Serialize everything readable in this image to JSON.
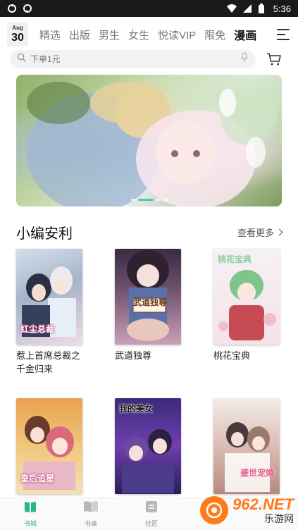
{
  "status_bar": {
    "time": "5:36"
  },
  "top_nav": {
    "date": {
      "month": "Aug",
      "day": "30"
    },
    "tabs": [
      {
        "label": "精选"
      },
      {
        "label": "出版"
      },
      {
        "label": "男生"
      },
      {
        "label": "女生"
      },
      {
        "label": "悦读VIP"
      },
      {
        "label": "限免"
      },
      {
        "label": "漫画",
        "active": true
      }
    ]
  },
  "search": {
    "placeholder": "下单1元"
  },
  "banner": {
    "slide_count": 4,
    "active_slide": 1
  },
  "section": {
    "title": "小编安利",
    "see_more": "查看更多",
    "books": [
      {
        "title": "惹上首席总裁之千金归来",
        "cover_text": "红尘总裁"
      },
      {
        "title": "武道独尊",
        "cover_text": "武道独尊"
      },
      {
        "title": "桃花宝典",
        "cover_text": "桃花宝典"
      },
      {
        "title": "",
        "cover_text": "皇后追星"
      },
      {
        "title": "",
        "cover_text": "我的美女"
      },
      {
        "title": "",
        "cover_text": "盛世宠婚"
      }
    ]
  },
  "bottom_nav": {
    "items": [
      {
        "label": "书城",
        "active": true
      },
      {
        "label": "书桌"
      },
      {
        "label": "社区"
      }
    ]
  },
  "watermark": {
    "brand": "962.NET",
    "sub": "乐游网"
  },
  "colors": {
    "accent": "#2bb58f",
    "tab_highlight": "#7fe0c9"
  }
}
